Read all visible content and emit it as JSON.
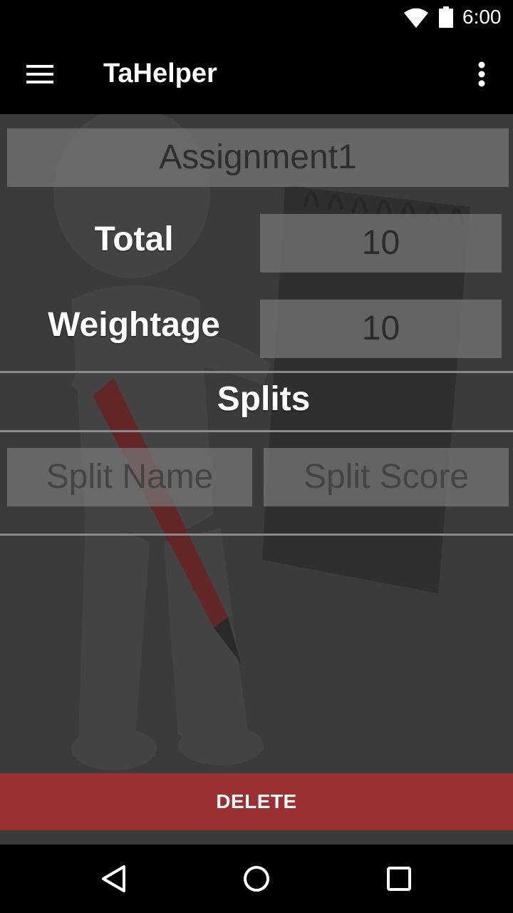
{
  "status_bar": {
    "time": "6:00"
  },
  "app_bar": {
    "title": "TaHelper",
    "menu_icon": "hamburger-menu-icon",
    "overflow_icon": "more-vert-icon"
  },
  "assignment": {
    "name": "Assignment1",
    "total_label": "Total",
    "total_value": "10",
    "weightage_label": "Weightage",
    "weightage_value": "10"
  },
  "splits": {
    "heading": "Splits",
    "name_placeholder": "Split Name",
    "score_placeholder": "Split Score"
  },
  "actions": {
    "delete_label": "DELETE"
  },
  "colors": {
    "delete_bg": "#9b3033",
    "content_bg": "#3b3b3b",
    "field_bg": "#787878"
  }
}
